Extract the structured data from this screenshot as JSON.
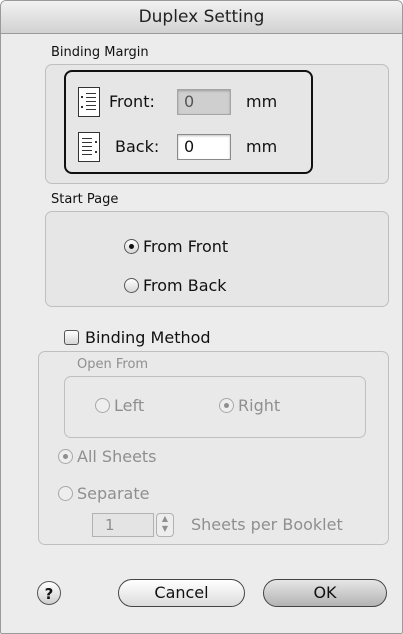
{
  "window": {
    "title": "Duplex Setting"
  },
  "binding_margin": {
    "label": "Binding Margin",
    "front": {
      "label": "Front:",
      "value": "0",
      "unit": "mm",
      "disabled": true
    },
    "back": {
      "label": "Back:",
      "value": "0",
      "unit": "mm",
      "disabled": false
    }
  },
  "start_page": {
    "label": "Start Page",
    "options": [
      {
        "label": "From Front",
        "selected": true
      },
      {
        "label": "From Back",
        "selected": false
      }
    ]
  },
  "binding_method": {
    "label": "Binding Method",
    "checked": false,
    "open_from": {
      "label": "Open From",
      "options": [
        {
          "label": "Left",
          "selected": false
        },
        {
          "label": "Right",
          "selected": true
        }
      ]
    },
    "sheets": [
      {
        "label": "All Sheets",
        "selected": true
      },
      {
        "label": "Separate",
        "selected": false
      }
    ],
    "sheets_per_booklet": {
      "value": "1",
      "label": "Sheets per Booklet"
    }
  },
  "buttons": {
    "help": "?",
    "cancel": "Cancel",
    "ok": "OK"
  }
}
